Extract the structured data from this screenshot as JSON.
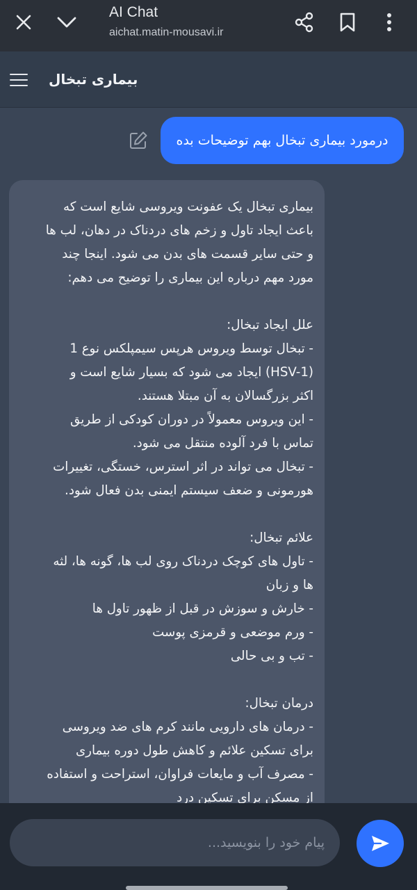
{
  "browser": {
    "title": "AI Chat",
    "url": "aichat.matin-mousavi.ir"
  },
  "header": {
    "title": "بیماری تبخال"
  },
  "chat": {
    "user_message": "درمورد بیماری تبخال بهم توضیحات بده",
    "bot_lines": [
      "بیماری تبخال یک عفونت ویروسی شایع است که",
      "باعث ایجاد تاول و زخم های دردناک در دهان، لب ها",
      "و حتی سایر قسمت های بدن می شود. اینجا چند",
      "مورد مهم درباره این بیماری را توضیح می دهم:",
      "",
      "علل ایجاد تبخال:",
      "- تبخال توسط ویروس هرپس سیمپلکس نوع 1",
      "(HSV-1) ایجاد می شود که بسیار شایع است و",
      "اکثر بزرگسالان به آن مبتلا هستند.",
      "- این ویروس معمولاً در دوران کودکی از طریق",
      "تماس با فرد آلوده منتقل می شود.",
      "- تبخال می تواند در اثر استرس، خستگی، تغییرات",
      "هورمونی و ضعف سیستم ایمنی بدن فعال شود.",
      "",
      "علائم تبخال:",
      "- تاول های کوچک دردناک روی لب ها، گونه ها، لثه",
      "ها و زبان",
      "- خارش و سوزش در قبل از ظهور تاول ها",
      "- ورم موضعی و قرمزی پوست",
      "- تب و بی حالی",
      "",
      "درمان تبخال:",
      "- درمان های دارویی مانند کرم های ضد ویروسی",
      "برای تسکین علائم و کاهش طول دوره بیماری",
      "- مصرف آب و مایعات فراوان، استراحت و استفاده",
      "از مسکن برای تسکین درد"
    ]
  },
  "input": {
    "placeholder": "پیام خود را بنویسید...",
    "value": ""
  },
  "colors": {
    "accent": "#2f72ff",
    "background": "#3a4556",
    "bot_bubble": "#4c5669"
  }
}
